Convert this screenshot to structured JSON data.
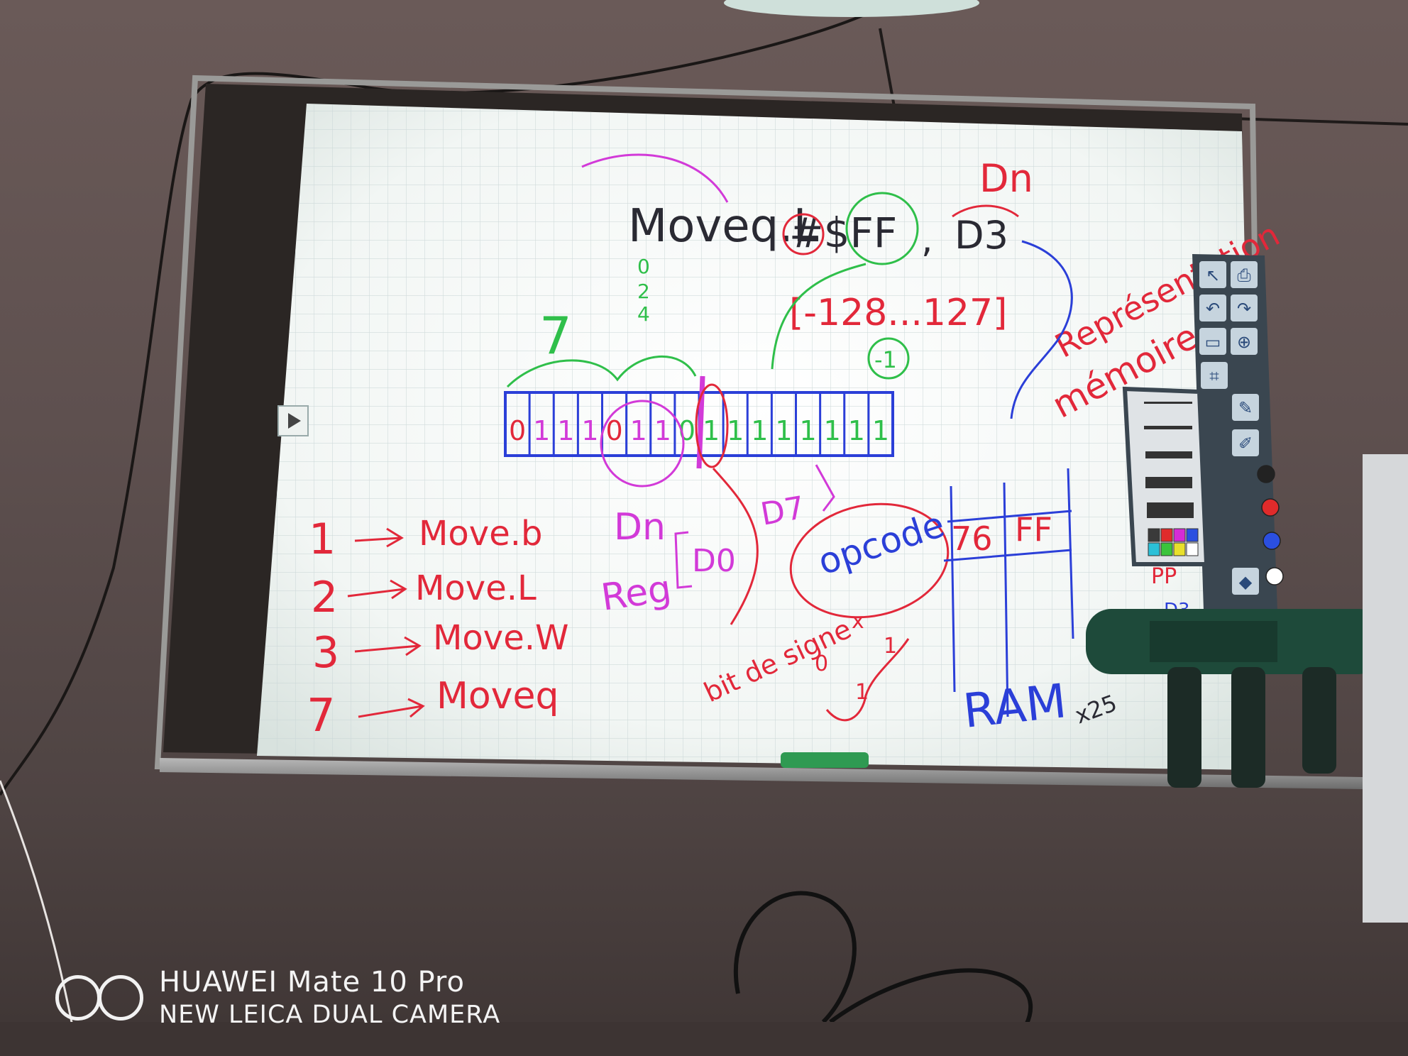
{
  "board": {
    "instruction": {
      "mnemonic": "Moveq.L",
      "immediate": "#$FF",
      "separator": ",",
      "destination": "D3",
      "dest_note": "Dn"
    },
    "size_digits": [
      "0",
      "2",
      "4"
    ],
    "range": "[-128...127]",
    "minus_one": "-1",
    "green_seven": "7",
    "bit_cells": [
      "0",
      "1",
      "1",
      "1",
      "0",
      "1",
      "1",
      "0",
      "1",
      "1",
      "1",
      "1",
      "1",
      "1",
      "1",
      "1"
    ],
    "sizes": [
      {
        "num": "1",
        "label": "Move.b"
      },
      {
        "num": "2",
        "label": "Move.L"
      },
      {
        "num": "3",
        "label": "Move.W"
      },
      {
        "num": "7",
        "label": "Moveq"
      }
    ],
    "dn_label": "Dn",
    "reg_label": "Reg",
    "d0_label": "D0",
    "d7_label": "D7",
    "opcode": "opcode",
    "bit_sign": "bit de signe",
    "sign_bits": [
      "0",
      "x",
      "1",
      "1"
    ],
    "repr": [
      "Représentation",
      "mémoire"
    ],
    "ram_cells": [
      "76",
      "FF"
    ],
    "ram_label": "RAM",
    "side_note": "x25",
    "ptr_label": "PP",
    "ptr_reg": "D3"
  },
  "colors": {
    "black_ink": "#2a2a33",
    "red_ink": "#e2283a",
    "blue_ink": "#2b3fd8",
    "green_ink": "#2fbf4a",
    "magenta_ink": "#d23ad8"
  },
  "toolbar_icons": [
    "cursor-icon",
    "printer-icon",
    "undo-icon",
    "redo-icon",
    "screen-icon",
    "zoom-icon",
    "capture-icon",
    "pen-icon",
    "highlighter-icon",
    "eraser-icon"
  ],
  "palette": [
    "#3a3a3a",
    "#e02b2b",
    "#d62bd6",
    "#2b4fe0",
    "#2bc0d8",
    "#3bc43b",
    "#e8e02b",
    "#ffffff"
  ],
  "watermark": {
    "line1": "HUAWEI Mate 10 Pro",
    "line2": "NEW LEICA DUAL CAMERA"
  }
}
